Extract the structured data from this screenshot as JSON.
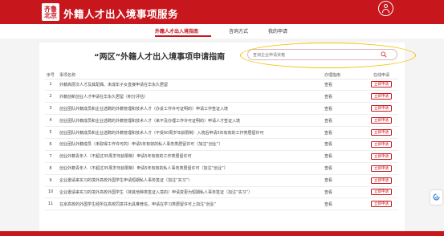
{
  "header": {
    "logo_text": "齐鲁\n北京",
    "site_title": "外籍人才出入境事项服务"
  },
  "nav": {
    "items": [
      {
        "label": "外籍人才出入境指南",
        "active": true
      },
      {
        "label": "咨询方式",
        "active": false
      },
      {
        "label": "我的申请",
        "active": false
      }
    ]
  },
  "main": {
    "title": "“两区”外籍人才出入境事项申请指南",
    "search_placeholder": "查询企业申请资格"
  },
  "table": {
    "headers": [
      "序号",
      "事项名称",
      "办理指南",
      "在线申请"
    ],
    "rows": [
      {
        "no": "1",
        "name": "外籍高层次人才及其配偶、未成年子女直接申请在华永久居留",
        "guide": "查看",
        "apply": "立即申请"
      },
      {
        "no": "2",
        "name": "外籍创新创业人才申请在华永久居留（积分评估）",
        "guide": "查看",
        "apply": "立即申请"
      },
      {
        "no": "3",
        "name": "创业团队外籍成员和企业选聘的外籍管理和技术人才（办妥工作许可证明的）申请工作签证入境",
        "guide": "查看",
        "apply": "立即申请"
      },
      {
        "no": "4",
        "name": "创业团队外籍成员和企业选聘的外籍管理和技术人才（来不及办理工作许可证明的）申请人才签证入境",
        "guide": "查看",
        "apply": "立即申请"
      },
      {
        "no": "5",
        "name": "创业团队外籍成员和企业选聘的外籍管理和技术人才（不受60周岁年龄限制）入境后申请5年有效的工作类居留许可",
        "guide": "查看",
        "apply": "立即申请"
      },
      {
        "no": "6",
        "name": "创业团队外籍成员（未取得工作许可的）申请5年有效的私人事务类居留许可（加注“创业”）",
        "guide": "查看",
        "apply": "立即申请"
      },
      {
        "no": "7",
        "name": "创业外籍青年人（不超过35周岁年龄限制）申请5年有效的工作类居留许可",
        "guide": "查看",
        "apply": "立即申请"
      },
      {
        "no": "8",
        "name": "创业外籍青年人（不超过35周岁年龄限制）申请5年有效的私人事务类居留许可（加注“创业”）",
        "guide": "查看",
        "apply": "立即申请"
      },
      {
        "no": "9",
        "name": "企业邀请来实习的境外高校外国学生申请短期私人事务签证（加注“实习”）",
        "guide": "查看",
        "apply": "立即申请"
      },
      {
        "no": "10",
        "name": "企业邀请来实习的境外高校外国学生（持其他种类签证入境的）申请变更为短期私人事务签证（加注“实习”）",
        "guide": "查看",
        "apply": "立即申请"
      },
      {
        "no": "11",
        "name": "在京高校的外国学生经所在高校同意并出具推荐信，申请在学习类居留许可上加注“创业”",
        "guide": "查看",
        "apply": "立即申请"
      }
    ]
  },
  "colors": {
    "brand": "#c8161d",
    "highlight": "#f2c200"
  }
}
